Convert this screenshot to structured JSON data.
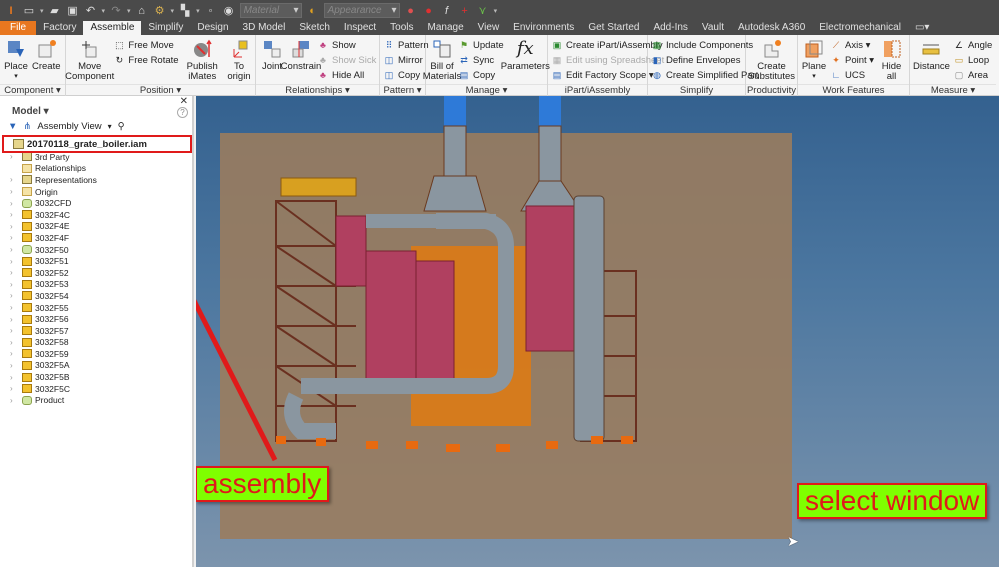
{
  "quick_access": {
    "app_logo": "inventor-pro-logo",
    "material_placeholder": "Material",
    "appearance_placeholder": "Appearance"
  },
  "tabs": [
    {
      "label": "File"
    },
    {
      "label": "Factory"
    },
    {
      "label": "Assemble",
      "active": true
    },
    {
      "label": "Simplify"
    },
    {
      "label": "Design"
    },
    {
      "label": "3D Model"
    },
    {
      "label": "Sketch"
    },
    {
      "label": "Inspect"
    },
    {
      "label": "Tools"
    },
    {
      "label": "Manage"
    },
    {
      "label": "View"
    },
    {
      "label": "Environments"
    },
    {
      "label": "Get Started"
    },
    {
      "label": "Add-Ins"
    },
    {
      "label": "Vault"
    },
    {
      "label": "Autodesk A360"
    },
    {
      "label": "Electromechanical"
    }
  ],
  "ribbon": {
    "component": {
      "title": "Component ▾",
      "place": "Place",
      "create": "Create"
    },
    "position": {
      "title": "Position ▾",
      "move_component": "Move Component",
      "free_move": "Free Move",
      "free_rotate": "Free Rotate",
      "publish_imates": "Publish iMates",
      "to_origin": "To origin"
    },
    "relationships": {
      "title": "Relationships ▾",
      "joint": "Joint",
      "constrain": "Constrain",
      "show": "Show",
      "show_sick": "Show Sick",
      "hide_all": "Hide All"
    },
    "pattern": {
      "title": "Pattern ▾",
      "pattern": "Pattern",
      "mirror": "Mirror",
      "copy": "Copy"
    },
    "manage": {
      "title": "Manage ▾",
      "bill_of_materials": "Bill of Materials",
      "update": "Update",
      "sync": "Sync",
      "copy": "Copy",
      "parameters": "Parameters"
    },
    "ipart": {
      "title": "iPart/iAssembly",
      "create": "Create iPart/iAssembly",
      "edit_spreadsheet": "Edit using Spreadsheet",
      "edit_factory_scope": "Edit Factory Scope ▾"
    },
    "simplify": {
      "title": "Simplify",
      "include_components": "Include Components",
      "define_envelopes": "Define Envelopes",
      "create_simplified_part": "Create Simplified Part"
    },
    "productivity": {
      "title": "Productivity",
      "create_substitutes": "Create Substitutes"
    },
    "work_features": {
      "title": "Work Features",
      "plane": "Plane",
      "axis": "Axis ▾",
      "point": "Point ▾",
      "ucs": "UCS",
      "hide_all": "Hide all"
    },
    "measure": {
      "title": "Measure ▾",
      "distance": "Distance",
      "angle": "Angle",
      "loop": "Loop",
      "area": "Area"
    }
  },
  "browser": {
    "title": "Model ▾",
    "view_label": "Assembly View",
    "root": "20170118_grate_boiler.iam",
    "nodes": [
      {
        "label": "3rd Party",
        "icon": "rep"
      },
      {
        "label": "Relationships",
        "icon": "folder",
        "noexp": true
      },
      {
        "label": "Representations",
        "icon": "rep"
      },
      {
        "label": "Origin",
        "icon": "folder"
      },
      {
        "label": "3032CFD",
        "icon": "sub"
      },
      {
        "label": "3032F4C",
        "icon": "part"
      },
      {
        "label": "3032F4E",
        "icon": "part"
      },
      {
        "label": "3032F4F",
        "icon": "part"
      },
      {
        "label": "3032F50",
        "icon": "sub"
      },
      {
        "label": "3032F51",
        "icon": "part"
      },
      {
        "label": "3032F52",
        "icon": "part"
      },
      {
        "label": "3032F53",
        "icon": "part"
      },
      {
        "label": "3032F54",
        "icon": "part"
      },
      {
        "label": "3032F55",
        "icon": "part"
      },
      {
        "label": "3032F56",
        "icon": "part"
      },
      {
        "label": "3032F57",
        "icon": "part"
      },
      {
        "label": "3032F58",
        "icon": "part"
      },
      {
        "label": "3032F59",
        "icon": "part"
      },
      {
        "label": "3032F5A",
        "icon": "part"
      },
      {
        "label": "3032F5B",
        "icon": "part"
      },
      {
        "label": "3032F5C",
        "icon": "part"
      },
      {
        "label": "Product",
        "icon": "sub"
      }
    ]
  },
  "annotations": {
    "assembly_label": "assembly",
    "select_window_label": "select window",
    "callout_bg": "#7fff00",
    "callout_fg": "#e01a1a"
  }
}
